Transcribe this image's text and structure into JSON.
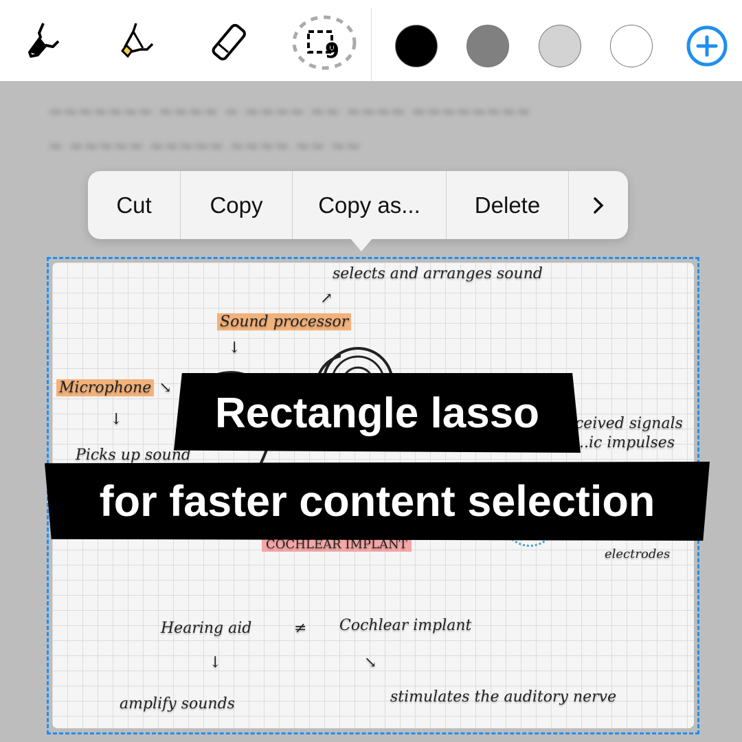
{
  "toolbar": {
    "tools": [
      {
        "icon": "fountain-pen-icon"
      },
      {
        "icon": "highlighter-icon",
        "color": "#f5cc45"
      },
      {
        "icon": "eraser-icon"
      },
      {
        "icon": "rectangle-lasso-icon"
      }
    ],
    "colors": [
      "#000000",
      "#808080",
      "#d3d3d3",
      "#ffffff"
    ],
    "add_color_icon": "plus-circle-icon",
    "accent": "#1f8ff0"
  },
  "context_menu": {
    "items": [
      "Cut",
      "Copy",
      "Copy as...",
      "Delete"
    ],
    "more_icon": "chevron-right-icon"
  },
  "note": {
    "labels": {
      "selects": "selects and arranges sound",
      "sound_processor": "Sound processor",
      "microphone": "Microphone",
      "picks_up": "Picks up sound",
      "received": "...ceived signals",
      "impulses": "...ic impulses",
      "cochlear_label": "COCHLEAR IMPLANT",
      "electrodes": "electrodes",
      "hearing_aid": "Hearing aid",
      "neq": "≠",
      "cochlear_implant": "Cochlear implant",
      "amplify": "amplify sounds",
      "stimulates": "stimulates the auditory nerve"
    }
  },
  "banner": {
    "line1": "Rectangle lasso",
    "line2": "for faster content selection"
  }
}
